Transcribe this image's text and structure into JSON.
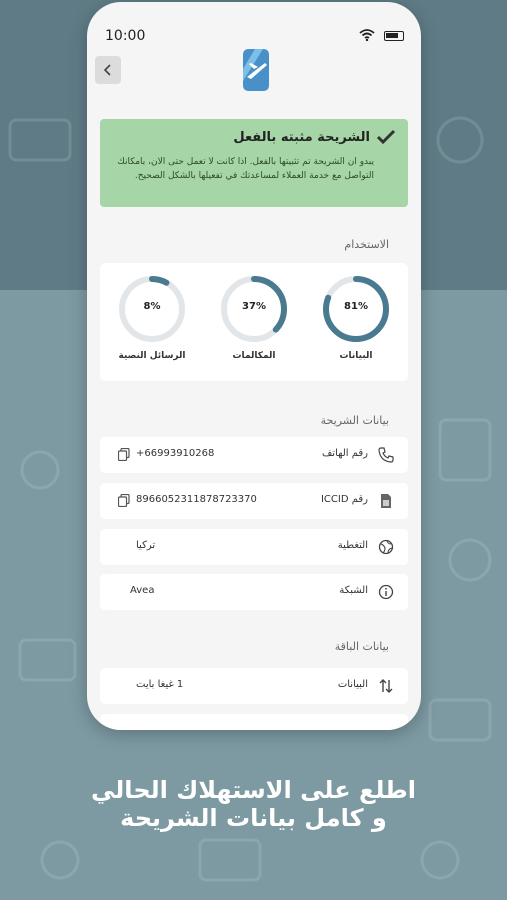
{
  "status_bar": {
    "time": "10:00"
  },
  "icons": {
    "back": "chevron-left-icon",
    "logo": "airplane-logo-icon",
    "check": "check-icon",
    "phone": "phone-icon",
    "sim": "sim-icon",
    "globe": "globe-icon",
    "info": "info-icon",
    "data": "up-down-arrows-icon",
    "copy": "copy-icon"
  },
  "colors": {
    "accent": "#4a7a8f",
    "alert_bg": "#a6d6a7",
    "gauge_track": "#e2e6e8"
  },
  "alert": {
    "title": "الشريحة مثبته بالفعل",
    "body": "يبدو ان الشريحة تم تثبيتها بالفعل. اذا كانت لا تعمل حتى الان، بامكانك التواصل مع خدمة العملاء لمساعدتك في تفعيلها بالشكل الصحيح."
  },
  "usage": {
    "title": "الاستخدام",
    "gauges": [
      {
        "label": "البيانات",
        "percent_text": "81%",
        "value": 81
      },
      {
        "label": "المكالمات",
        "percent_text": "37%",
        "value": 37
      },
      {
        "label": "الرسائل النصية",
        "percent_text": "8%",
        "value": 8
      }
    ]
  },
  "sim_info": {
    "title": "بيانات الشريحة",
    "rows": [
      {
        "label": "رقم الهاتف",
        "value": "+66993910268"
      },
      {
        "label": "رقم ICCID",
        "value": "8966052311878723370"
      },
      {
        "label": "التغطية",
        "value": "تركيا"
      },
      {
        "label": "الشبكة",
        "value": "Avea"
      }
    ]
  },
  "package": {
    "title": "بيانات الباقة",
    "rows": [
      {
        "label": "البيانات",
        "value": "1 غيغا بايت"
      }
    ]
  },
  "caption": {
    "line1": "اطلع على الاستهلاك الحالي",
    "line2": "و كامل بيانات الشريحة"
  }
}
